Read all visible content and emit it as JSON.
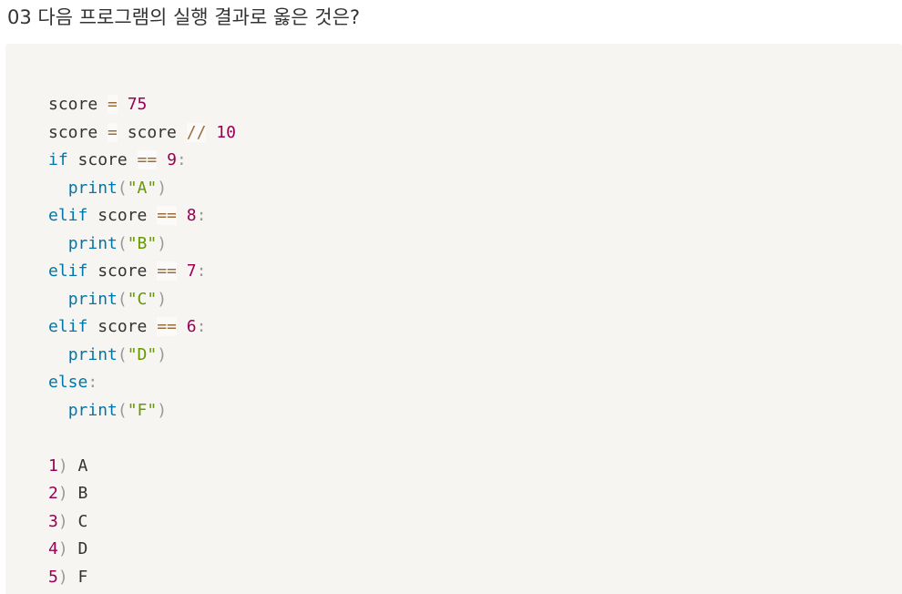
{
  "question": "03 다음 프로그램의 실행 결과로 옳은 것은?",
  "code_lines": [
    [
      {
        "t": "score ",
        "c": "plain"
      },
      {
        "t": "=",
        "c": "op"
      },
      {
        "t": " ",
        "c": "plain"
      },
      {
        "t": "75",
        "c": "num"
      }
    ],
    [
      {
        "t": "score ",
        "c": "plain"
      },
      {
        "t": "=",
        "c": "op"
      },
      {
        "t": " score ",
        "c": "plain"
      },
      {
        "t": "//",
        "c": "op"
      },
      {
        "t": " ",
        "c": "plain"
      },
      {
        "t": "10",
        "c": "num"
      }
    ],
    [
      {
        "t": "if",
        "c": "kw"
      },
      {
        "t": " score ",
        "c": "plain"
      },
      {
        "t": "==",
        "c": "op"
      },
      {
        "t": " ",
        "c": "plain"
      },
      {
        "t": "9",
        "c": "num"
      },
      {
        "t": ":",
        "c": "punc"
      }
    ],
    [
      {
        "t": "  ",
        "c": "plain"
      },
      {
        "t": "print",
        "c": "kw"
      },
      {
        "t": "(",
        "c": "punc"
      },
      {
        "t": "\"A\"",
        "c": "str"
      },
      {
        "t": ")",
        "c": "punc"
      }
    ],
    [
      {
        "t": "elif",
        "c": "kw"
      },
      {
        "t": " score ",
        "c": "plain"
      },
      {
        "t": "==",
        "c": "op"
      },
      {
        "t": " ",
        "c": "plain"
      },
      {
        "t": "8",
        "c": "num"
      },
      {
        "t": ":",
        "c": "punc"
      }
    ],
    [
      {
        "t": "  ",
        "c": "plain"
      },
      {
        "t": "print",
        "c": "kw"
      },
      {
        "t": "(",
        "c": "punc"
      },
      {
        "t": "\"B\"",
        "c": "str"
      },
      {
        "t": ")",
        "c": "punc"
      }
    ],
    [
      {
        "t": "elif",
        "c": "kw"
      },
      {
        "t": " score ",
        "c": "plain"
      },
      {
        "t": "==",
        "c": "op"
      },
      {
        "t": " ",
        "c": "plain"
      },
      {
        "t": "7",
        "c": "num"
      },
      {
        "t": ":",
        "c": "punc"
      }
    ],
    [
      {
        "t": "  ",
        "c": "plain"
      },
      {
        "t": "print",
        "c": "kw"
      },
      {
        "t": "(",
        "c": "punc"
      },
      {
        "t": "\"C\"",
        "c": "str"
      },
      {
        "t": ")",
        "c": "punc"
      }
    ],
    [
      {
        "t": "elif",
        "c": "kw"
      },
      {
        "t": " score ",
        "c": "plain"
      },
      {
        "t": "==",
        "c": "op"
      },
      {
        "t": " ",
        "c": "plain"
      },
      {
        "t": "6",
        "c": "num"
      },
      {
        "t": ":",
        "c": "punc"
      }
    ],
    [
      {
        "t": "  ",
        "c": "plain"
      },
      {
        "t": "print",
        "c": "kw"
      },
      {
        "t": "(",
        "c": "punc"
      },
      {
        "t": "\"D\"",
        "c": "str"
      },
      {
        "t": ")",
        "c": "punc"
      }
    ],
    [
      {
        "t": "else",
        "c": "kw"
      },
      {
        "t": ":",
        "c": "punc"
      }
    ],
    [
      {
        "t": "  ",
        "c": "plain"
      },
      {
        "t": "print",
        "c": "kw"
      },
      {
        "t": "(",
        "c": "punc"
      },
      {
        "t": "\"F\"",
        "c": "str"
      },
      {
        "t": ")",
        "c": "punc"
      }
    ],
    [],
    [
      {
        "t": "1",
        "c": "num"
      },
      {
        "t": ")",
        "c": "punc"
      },
      {
        "t": " A",
        "c": "plain"
      }
    ],
    [
      {
        "t": "2",
        "c": "num"
      },
      {
        "t": ")",
        "c": "punc"
      },
      {
        "t": " B",
        "c": "plain"
      }
    ],
    [
      {
        "t": "3",
        "c": "num"
      },
      {
        "t": ")",
        "c": "punc"
      },
      {
        "t": " C",
        "c": "plain"
      }
    ],
    [
      {
        "t": "4",
        "c": "num"
      },
      {
        "t": ")",
        "c": "punc"
      },
      {
        "t": " D",
        "c": "plain"
      }
    ],
    [
      {
        "t": "5",
        "c": "num"
      },
      {
        "t": ")",
        "c": "punc"
      },
      {
        "t": " F",
        "c": "plain"
      }
    ]
  ],
  "colors": {
    "background": "#ffffff",
    "code_background": "#f6f5f2",
    "text": "#333333",
    "keyword": "#0077aa",
    "number": "#990055",
    "string": "#669900",
    "operator": "#9a6e3a",
    "punctuation": "#999999"
  }
}
